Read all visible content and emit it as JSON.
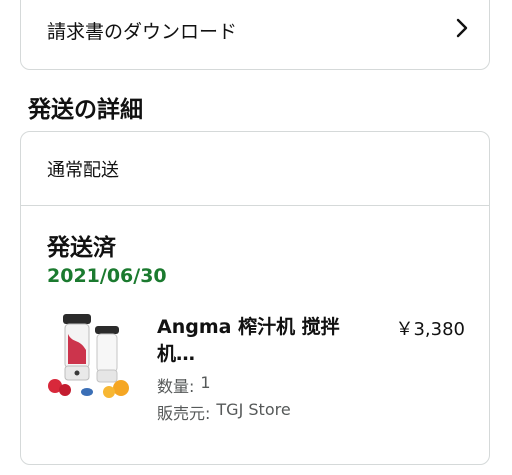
{
  "invoice": {
    "label": "請求書のダウンロード",
    "chevron_icon": "chevron-right-icon"
  },
  "shipping_section": {
    "title": "発送の詳細"
  },
  "shipment": {
    "method": "通常配送",
    "status": "発送済",
    "date": "2021/06/30",
    "status_color": "#1b7a2f"
  },
  "product": {
    "name": "Angma 榨汁机 搅拌机…",
    "price": "￥3,380",
    "qty_label": "数量:",
    "qty_value": "1",
    "seller_label": "販売元:",
    "seller_value": "TGJ Store",
    "image_icon": "portable-blender-product-image"
  }
}
